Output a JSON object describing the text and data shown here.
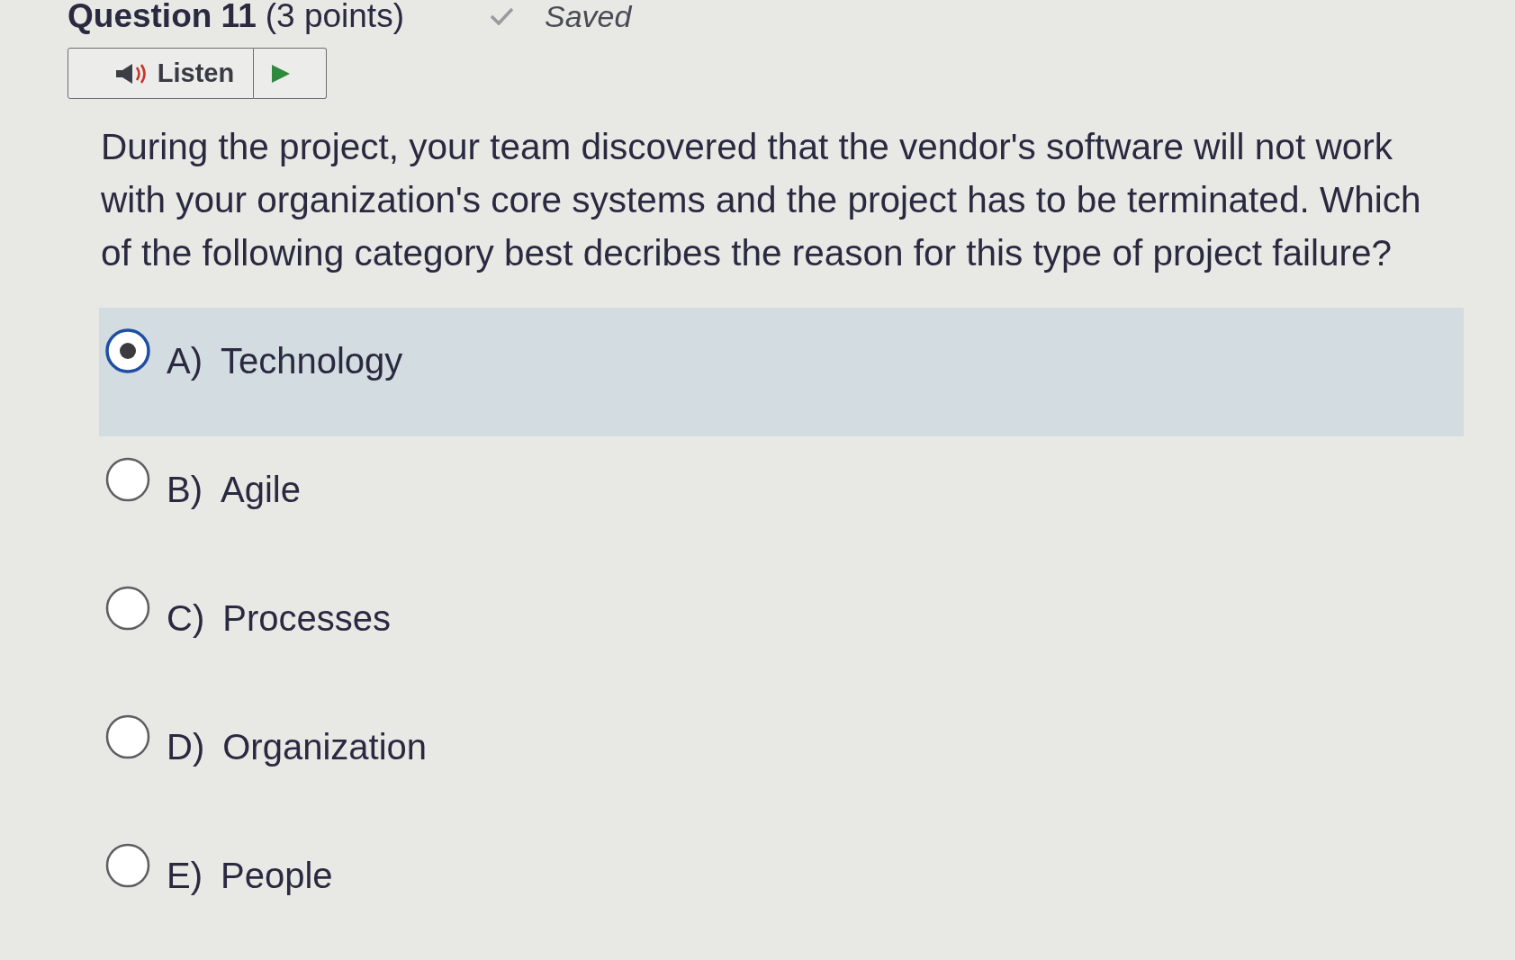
{
  "header": {
    "title": "Question 11",
    "points": "(3 points)",
    "status": "Saved"
  },
  "listen": {
    "label": "Listen"
  },
  "prompt": "During the project, your team discovered that the vendor's software will not work with your organization's core systems and the project has to be terminated. Which of the following category best decribes the reason for this type of project failure?",
  "options": [
    {
      "letter": "A)",
      "label": "Technology",
      "selected": true
    },
    {
      "letter": "B)",
      "label": "Agile",
      "selected": false
    },
    {
      "letter": "C)",
      "label": "Processes",
      "selected": false
    },
    {
      "letter": "D)",
      "label": "Organization",
      "selected": false
    },
    {
      "letter": "E)",
      "label": "People",
      "selected": false
    }
  ]
}
